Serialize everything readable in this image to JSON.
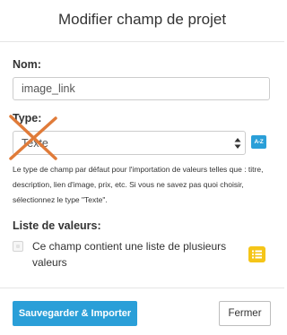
{
  "modal": {
    "title": "Modifier champ de projet"
  },
  "name_field": {
    "label": "Nom:",
    "value": "image_link"
  },
  "type_field": {
    "label": "Type:",
    "selected": "Texte",
    "az_icon": "sort-alpha-icon",
    "help_text": "Le type de champ par défaut pour l'importation de valeurs telles que : titre, description, lien d'image, prix, etc. Si vous ne savez pas quoi choisir, sélectionnez le type \"Texte\"."
  },
  "values_list": {
    "label": "Liste de valeurs:",
    "checkbox_label": "Ce champ contient une liste de plusieurs valeurs",
    "checked": false,
    "list_icon": "list-icon"
  },
  "footer": {
    "save_label": "Sauvegarder & Importer",
    "close_label": "Fermer"
  },
  "colors": {
    "primary": "#2a9fd8",
    "warning_icon": "#f5c518",
    "cross_annotation": "#e07b39"
  }
}
